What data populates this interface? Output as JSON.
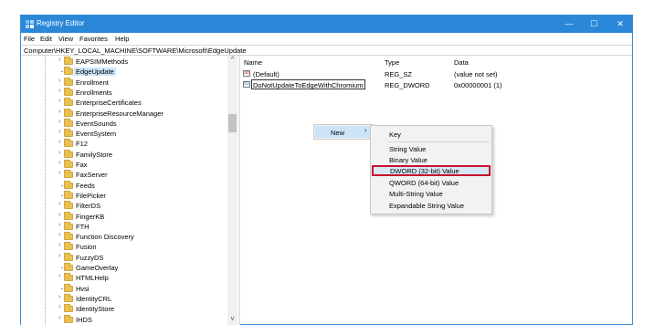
{
  "window": {
    "title": "Registry Editor",
    "controls": [
      "—",
      "☐",
      "✕"
    ]
  },
  "menu": [
    "File",
    "Edit",
    "View",
    "Favorites",
    "Help"
  ],
  "address": "Computer\\HKEY_LOCAL_MACHINE\\SOFTWARE\\Microsoft\\EdgeUpdate",
  "tree": [
    {
      "label": "EAPSIMMethods",
      "expandable": true
    },
    {
      "label": "EdgeUpdate",
      "expandable": false,
      "selected": true
    },
    {
      "label": "Enrollment",
      "expandable": true
    },
    {
      "label": "Enrollments",
      "expandable": true
    },
    {
      "label": "EnterpriseCertificates",
      "expandable": true
    },
    {
      "label": "EnterpriseResourceManager",
      "expandable": true
    },
    {
      "label": "EventSounds",
      "expandable": true
    },
    {
      "label": "EventSystem",
      "expandable": true
    },
    {
      "label": "F12",
      "expandable": true
    },
    {
      "label": "FamilyStore",
      "expandable": true
    },
    {
      "label": "Fax",
      "expandable": true
    },
    {
      "label": "FaxServer",
      "expandable": true
    },
    {
      "label": "Feeds",
      "expandable": false
    },
    {
      "label": "FilePicker",
      "expandable": false
    },
    {
      "label": "FilterDS",
      "expandable": true
    },
    {
      "label": "FingerKB",
      "expandable": true
    },
    {
      "label": "FTH",
      "expandable": true
    },
    {
      "label": "Function Discovery",
      "expandable": true
    },
    {
      "label": "Fusion",
      "expandable": true
    },
    {
      "label": "FuzzyDS",
      "expandable": true
    },
    {
      "label": "GameOverlay",
      "expandable": false
    },
    {
      "label": "HTMLHelp",
      "expandable": true
    },
    {
      "label": "Hvsi",
      "expandable": false
    },
    {
      "label": "IdentityCRL",
      "expandable": true
    },
    {
      "label": "IdentityStore",
      "expandable": true
    },
    {
      "label": "IHDS",
      "expandable": true
    }
  ],
  "values_header": {
    "name": "Name",
    "type": "Type",
    "data": "Data"
  },
  "values": [
    {
      "name": "(Default)",
      "type": "REG_SZ",
      "data": "(value not set)",
      "icon": "string-value-icon"
    },
    {
      "name": "DoNotUpdateToEdgeWithChromium",
      "type": "REG_DWORD",
      "data": "0x00000001 (1)",
      "icon": "dword-value-icon",
      "editing": true
    }
  ],
  "context_menu": {
    "new_label": "New",
    "arrow": "›"
  },
  "submenu": {
    "key": "Key",
    "items": [
      "String Value",
      "Binary Value",
      "DWORD (32-bit) Value",
      "QWORD (64-bit) Value",
      "Multi-String Value",
      "Expandable String Value"
    ],
    "highlighted": "DWORD (32-bit) Value"
  },
  "colors": {
    "titlebar": "#2b88d8",
    "selection": "#cce4f7",
    "highlight_border": "#c8102e"
  }
}
